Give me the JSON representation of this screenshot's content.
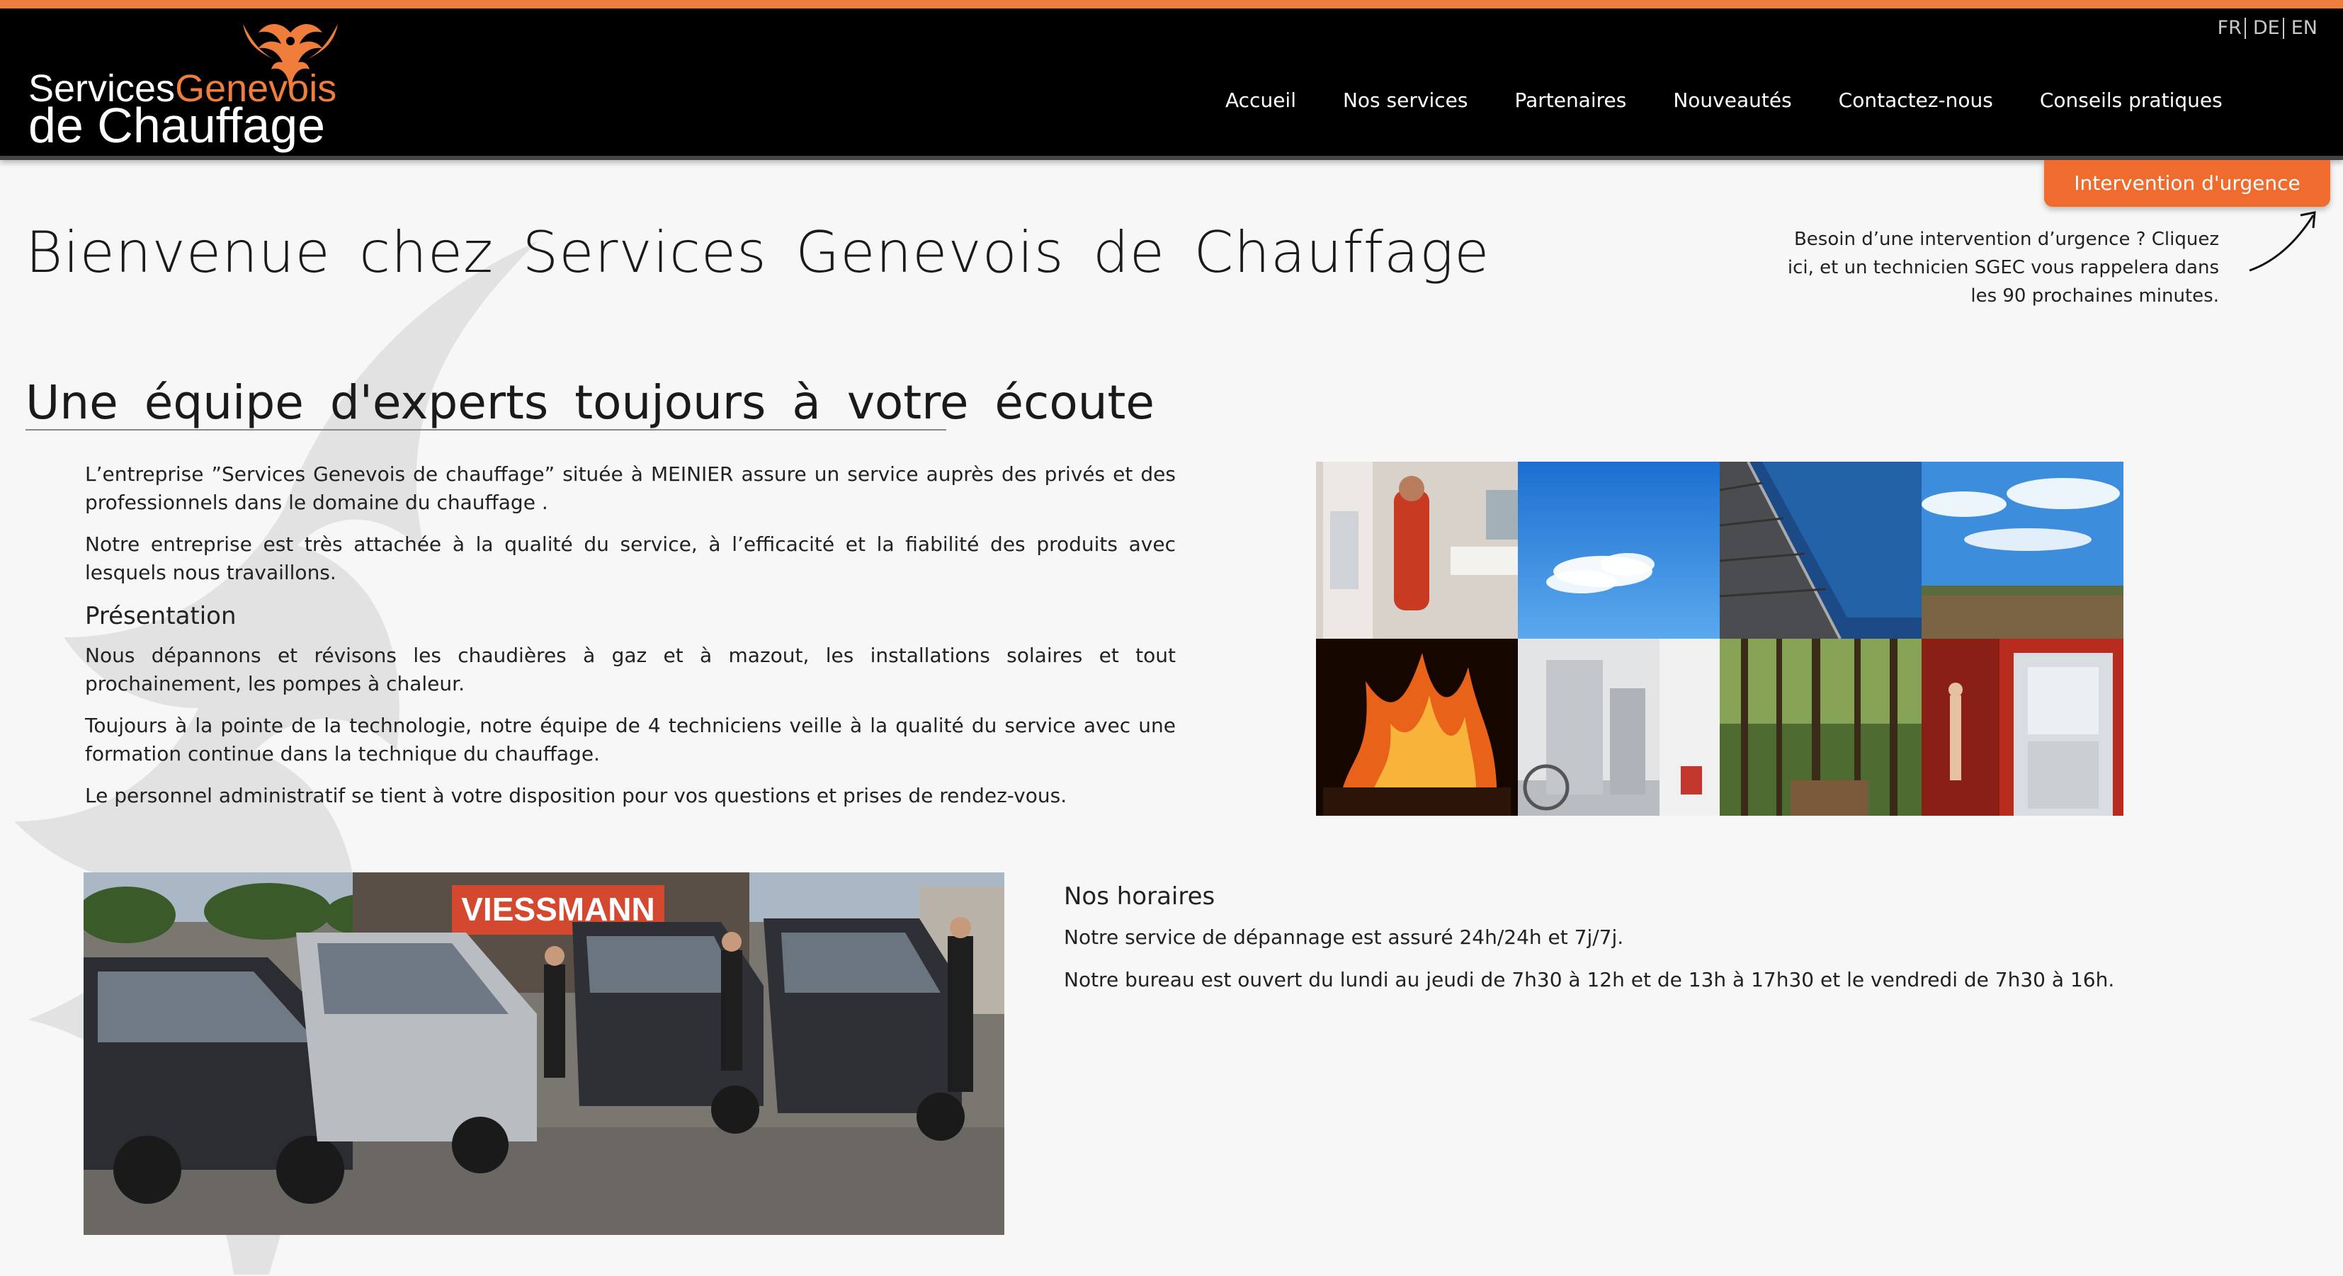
{
  "brand": {
    "logo_line1_white": "Services",
    "logo_line1_orange": "Genevois",
    "logo_line2": "de Chauffage",
    "accent_color": "#ef7d3b"
  },
  "languages": [
    "FR",
    "DE",
    "EN"
  ],
  "nav": [
    {
      "label": "Accueil"
    },
    {
      "label": "Nos services"
    },
    {
      "label": "Partenaires"
    },
    {
      "label": "Nouveautés"
    },
    {
      "label": "Contactez-nous"
    },
    {
      "label": "Conseils pratiques"
    }
  ],
  "urgent": {
    "button_label": "Intervention d'urgence",
    "text": "Besoin d’une intervention d’urgence ? Cliquez ici, et un technicien SGEC vous rappelera dans les 90 prochaines minutes."
  },
  "page_title": "Bienvenue chez Services Genevois de Chauffage",
  "subtitle": "Une équipe d'experts toujours à votre écoute",
  "intro": {
    "p1": "L’entreprise ”Services Genevois de chauffage” située à MEINIER assure un service auprès des privés et des professionnels dans le domaine du chauffage .",
    "p2": "Notre entreprise est très attachée à la qualité du service, à l’efficacité et la fiabilité des produits avec lesquels nous travaillons."
  },
  "presentation": {
    "heading": "Présentation",
    "p1": "Nous dépannons et révisons les chaudières à gaz et à mazout, les installations solaires et tout prochainement, les pompes à chaleur.",
    "p2": "Toujours à la pointe de la technologie, notre équipe de 4 techniciens veille à la qualité du service avec une formation continue dans la technique du chauffage.",
    "p3": "Le personnel administratif se tient à votre disposition pour vos questions et prises de rendez-vous."
  },
  "hours": {
    "heading": "Nos horaires",
    "p1": "Notre service de dépannage est assuré 24h/24h et 7j/7j.",
    "p2": "Notre bureau est ouvert du lundi au jeudi de 7h30 à 12h et de 13h à 17h30 et le vendredi de 7h30 à 16h."
  },
  "vans_photo": {
    "banner_text": "VIESSMANN"
  }
}
